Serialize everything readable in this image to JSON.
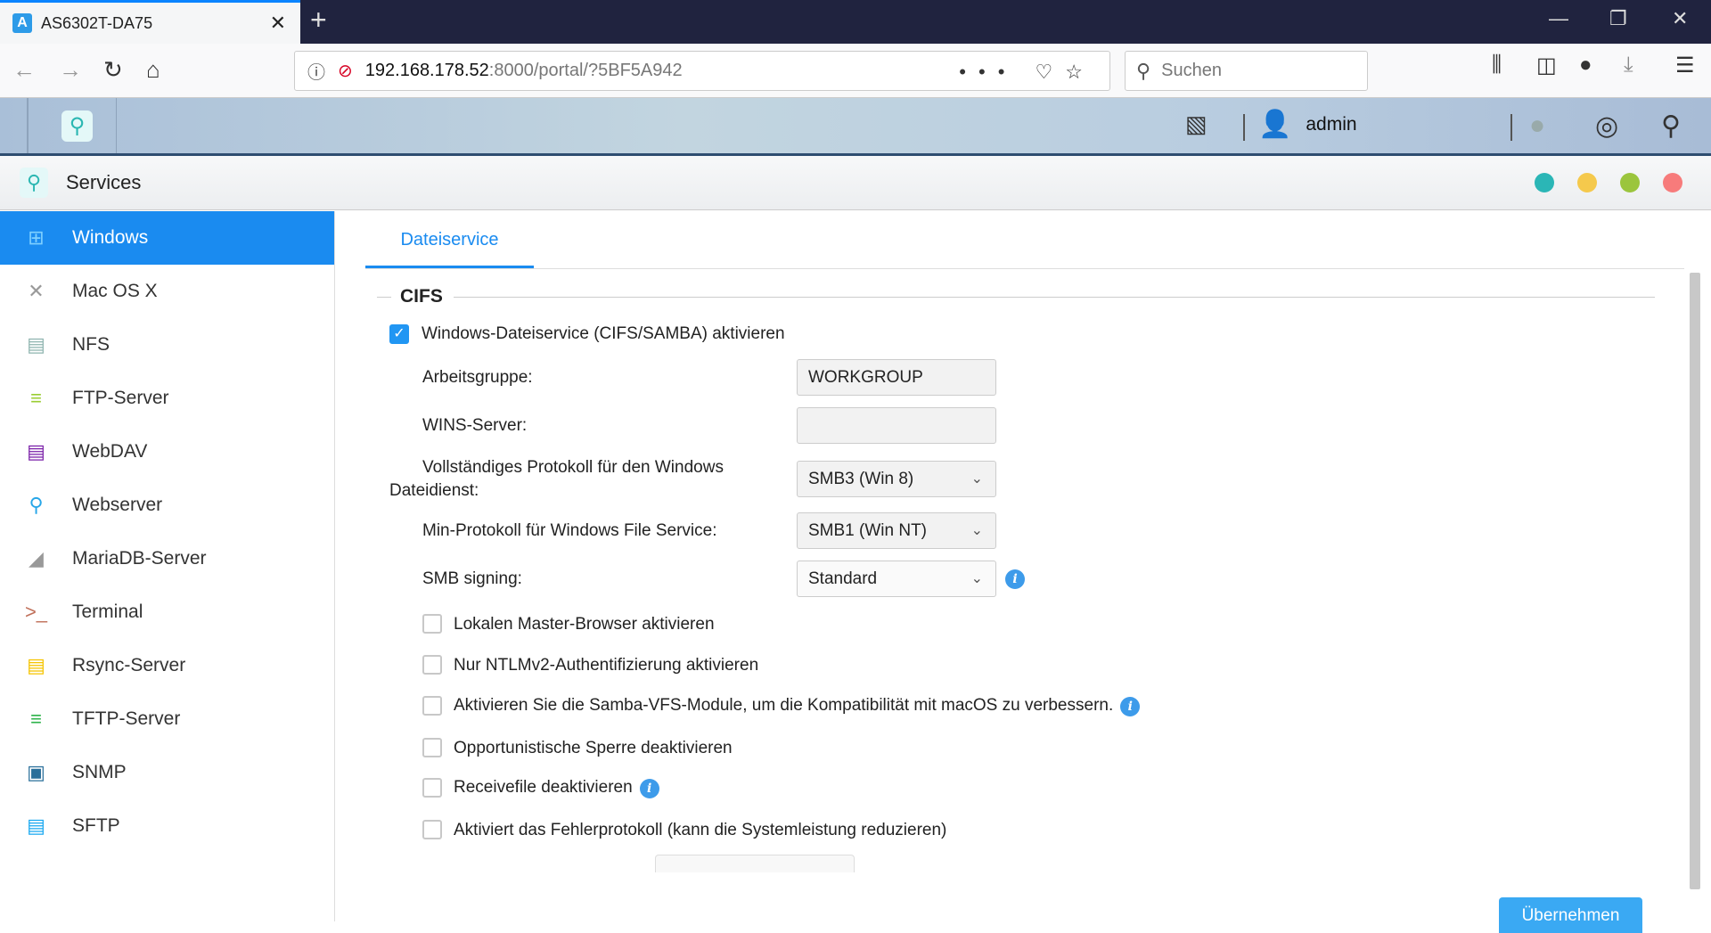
{
  "browser": {
    "tab_title": "AS6302T-DA75",
    "url_host": "192.168.178.52",
    "url_rest": ":8000/portal/?5BF5A942",
    "search_placeholder": "Suchen"
  },
  "app": {
    "username": "admin",
    "window_title": "Services",
    "dot_colors": [
      "#2bb6b6",
      "#f5c94c",
      "#9bc53d",
      "#f77b7b"
    ]
  },
  "sidebar": {
    "items": [
      {
        "label": "Windows",
        "icon": "windows-icon",
        "active": true
      },
      {
        "label": "Mac OS X",
        "icon": "mac-icon"
      },
      {
        "label": "NFS",
        "icon": "nfs-icon"
      },
      {
        "label": "FTP-Server",
        "icon": "ftp-icon"
      },
      {
        "label": "WebDAV",
        "icon": "webdav-icon"
      },
      {
        "label": "Webserver",
        "icon": "webserver-icon"
      },
      {
        "label": "MariaDB-Server",
        "icon": "mariadb-icon"
      },
      {
        "label": "Terminal",
        "icon": "terminal-icon"
      },
      {
        "label": "Rsync-Server",
        "icon": "rsync-icon"
      },
      {
        "label": "TFTP-Server",
        "icon": "tftp-icon"
      },
      {
        "label": "SNMP",
        "icon": "snmp-icon"
      },
      {
        "label": "SFTP",
        "icon": "sftp-icon"
      }
    ]
  },
  "main": {
    "tab": "Dateiservice",
    "section": "CIFS",
    "enable_label": "Windows-Dateiservice (CIFS/SAMBA) aktivieren",
    "enable_checked": true,
    "workgroup_label": "Arbeitsgruppe:",
    "workgroup_value": "WORKGROUP",
    "wins_label": "WINS-Server:",
    "wins_value": "",
    "max_proto_label_1": "Vollständiges Protokoll für den Windows",
    "max_proto_label_2": "Dateidienst:",
    "max_proto_value": "SMB3 (Win 8)",
    "min_proto_label": "Min-Protokoll für Windows File Service:",
    "min_proto_value": "SMB1 (Win NT)",
    "signing_label": "SMB signing:",
    "signing_value": "Standard",
    "options": [
      {
        "label": "Lokalen Master-Browser aktivieren",
        "checked": false
      },
      {
        "label": "Nur NTLMv2-Authentifizierung aktivieren",
        "checked": false
      },
      {
        "label": "Aktivieren Sie die Samba-VFS-Module, um die Kompatibilität mit macOS zu verbessern.",
        "checked": false,
        "info": true
      },
      {
        "label": "Opportunistische Sperre deaktivieren",
        "checked": false
      },
      {
        "label": "Receivefile deaktivieren",
        "checked": false,
        "info": true
      },
      {
        "label": "Aktiviert das Fehlerprotokoll (kann die Systemleistung reduzieren)",
        "checked": false
      }
    ],
    "apply_label": "Übernehmen"
  }
}
